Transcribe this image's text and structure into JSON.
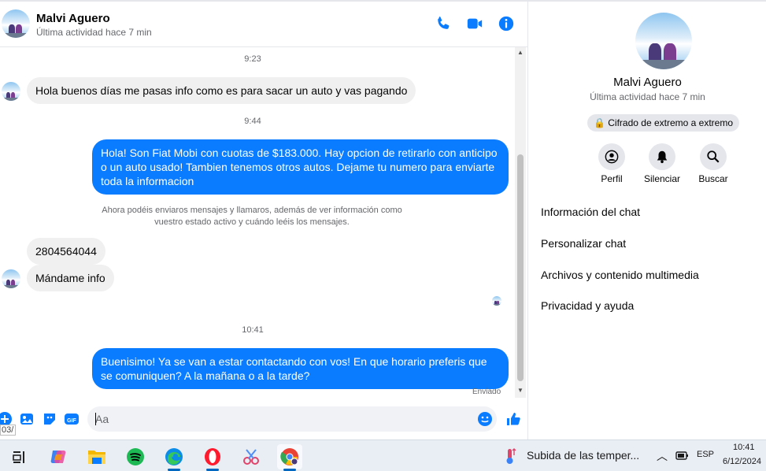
{
  "header": {
    "name": "Malvi Aguero",
    "status": "Última actividad hace 7 min"
  },
  "messages": {
    "time1": "9:23",
    "msg1": "Hola buenos días me pasas info como es para sacar un auto y vas pagando",
    "time2": "9:44",
    "msg2": "Hola! Son Fiat Mobi con cuotas de $183.000. Hay opcion de retirarlo con anticipo o un auto usado! Tambien tenemos otros autos. Dejame tu numero para enviarte toda la informacion",
    "system": "Ahora podéis enviaros mensajes y llamaros, además de ver información como vuestro estado activo y cuándo leéis los mensajes.",
    "msg3": "2804564044",
    "msg4": "Mándame info",
    "time3": "10:41",
    "msg5": "Buenisimo! Ya se van a estar contactando con vos! En que horario preferis que se comuniquen? A la mañana o a la tarde?",
    "sent_label": "Enviado"
  },
  "composer": {
    "placeholder": "Aa",
    "clipped_text": "03/"
  },
  "side": {
    "name": "Malvi Aguero",
    "status": "Última actividad hace 7 min",
    "encryption": "Cifrado de extremo a extremo",
    "actions": [
      "Perfil",
      "Silenciar",
      "Buscar"
    ],
    "menu": [
      "Información del chat",
      "Personalizar chat",
      "Archivos y contenido multimedia",
      "Privacidad y ayuda"
    ]
  },
  "taskbar": {
    "weather": "Subida de las temper...",
    "lang": "ESP",
    "time": "10:41",
    "date": "6/12/2024"
  },
  "colors": {
    "accent": "#0a7cff",
    "incoming_bubble": "#f0f0f0"
  }
}
